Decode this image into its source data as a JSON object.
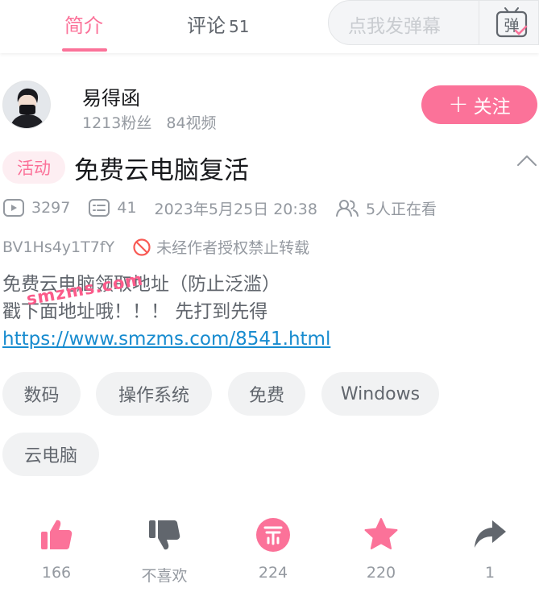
{
  "tabs": [
    {
      "label": "简介",
      "count": ""
    },
    {
      "label": "评论",
      "count": "51"
    }
  ],
  "danmaku": {
    "placeholder": "点我发弹幕",
    "icon_label": "弹"
  },
  "uploader": {
    "name": "易得函",
    "followers": "1213粉丝",
    "videos": "84视频",
    "follow_label": "关注"
  },
  "video": {
    "badge": "活动",
    "title": "免费云电脑复活",
    "plays": "3297",
    "danmaku_count": "41",
    "datetime": "2023年5月25日 20:38",
    "watching": "5人正在看",
    "bvid": "BV1Hs4y1T7fY",
    "copyright": "未经作者授权禁止转载",
    "description_line1": "免费云电脑领取地址（防止泛滥）",
    "description_line2": "戳下面地址哦！！！ 先打到先得",
    "link": "https://www.smzms.com/8541.html",
    "watermark": "smzms.com"
  },
  "tags": [
    "数码",
    "操作系统",
    "免费",
    "Windows",
    "云电脑"
  ],
  "actions": [
    {
      "icon": "thumbs-up-icon",
      "label": "166"
    },
    {
      "icon": "thumbs-down-icon",
      "label": "不喜欢"
    },
    {
      "icon": "coin-icon",
      "label": "224"
    },
    {
      "icon": "star-icon",
      "label": "220"
    },
    {
      "icon": "share-icon",
      "label": "1"
    }
  ],
  "colors": {
    "accent": "#fb7299",
    "link": "#178bcf",
    "muted": "#9499a0",
    "tag_bg": "#f1f2f3"
  }
}
